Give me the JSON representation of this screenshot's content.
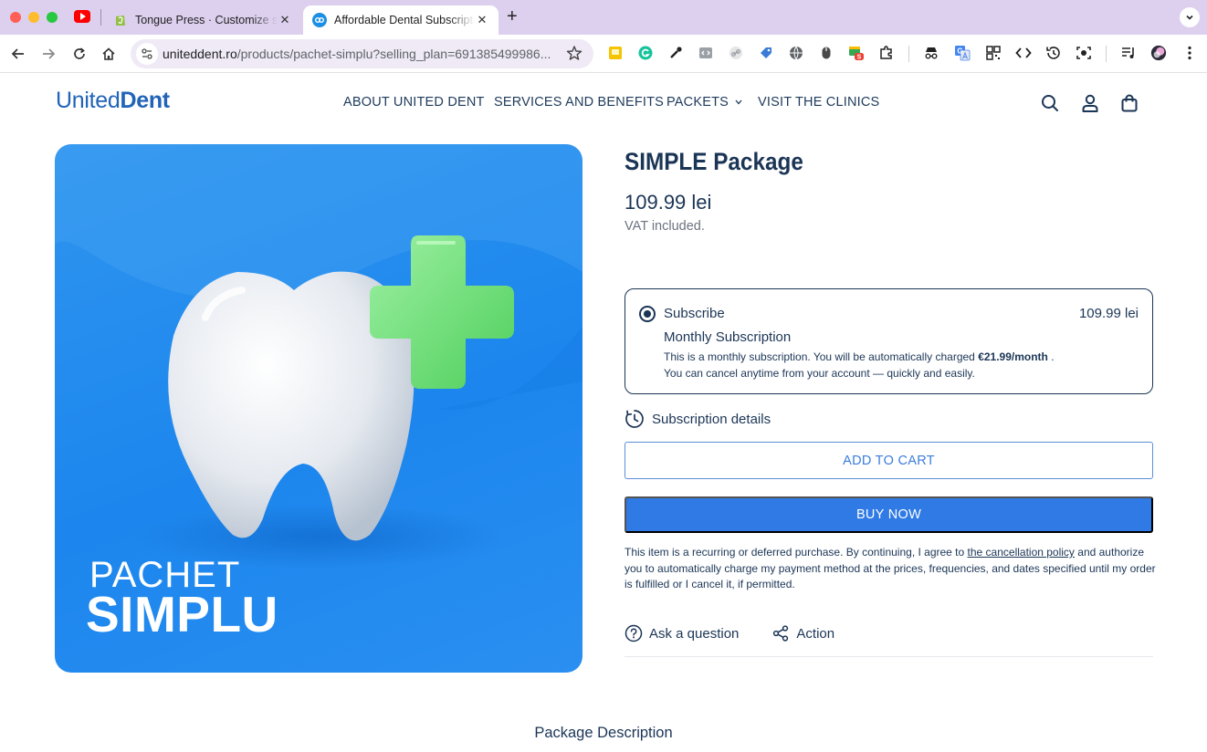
{
  "browser": {
    "tabs": [
      {
        "title": "Tongue Press · Customize sh",
        "favicon": "shopify-icon",
        "active": false
      },
      {
        "title": "Affordable Dental Subscriptio",
        "favicon": "uniteddent-icon",
        "active": true
      }
    ],
    "url_host": "uniteddent.ro",
    "url_path": "/products/pachet-simplu?selling_plan=691385499986...",
    "extensions": [
      "sticky-note-icon",
      "grammarly-icon",
      "eyedropper-icon",
      "code-icon",
      "link-icon",
      "tag-icon",
      "globe-icon",
      "mouse-icon",
      "badge-icon",
      "puzzle-icon",
      "incognito-icon",
      "translate-icon",
      "qr-icon",
      "devtools-icon",
      "history-icon",
      "screenshot-icon",
      "media-icon",
      "profile-avatar"
    ],
    "extension_badge": "S"
  },
  "site": {
    "logo_light": "United",
    "logo_bold": "Dent",
    "nav": [
      {
        "label": "ABOUT UNITED DENT"
      },
      {
        "label": "SERVICES AND BENEFITS"
      },
      {
        "label": "PACKETS"
      },
      {
        "label": "VISIT THE CLINICS"
      }
    ],
    "header_icons": [
      "search-icon",
      "account-icon",
      "cart-icon"
    ],
    "brand_color": "#2163B8"
  },
  "product": {
    "image_text_line1": "PACHET",
    "image_text_line2": "SIMPLU",
    "title": "SIMPLE Package",
    "price": "109.99 lei",
    "vat": "VAT included.",
    "subscription": {
      "label": "Subscribe",
      "price": "109.99 lei",
      "name": "Monthly Subscription",
      "desc_prefix": "This is a monthly subscription. You will be automatically charged",
      "desc_amount": "€21.99/month",
      "desc_suffix": ".",
      "desc_line2": "You can cancel anytime from your account — quickly and easily."
    },
    "subscription_details": "Subscription details",
    "add_to_cart": "ADD TO CART",
    "buy_now": "BUY NOW",
    "legal_before": "This item is a recurring or deferred purchase. By continuing, I agree to",
    "legal_link": "the cancellation policy",
    "legal_after": "and authorize you to automatically charge my payment method at the prices, frequencies, and dates specified until my order is fulfilled or I cancel it, if permitted.",
    "ask_question": "Ask a question",
    "action": "Action",
    "accent_color": "#2F7AE5"
  },
  "section": {
    "package_description": "Package Description"
  }
}
